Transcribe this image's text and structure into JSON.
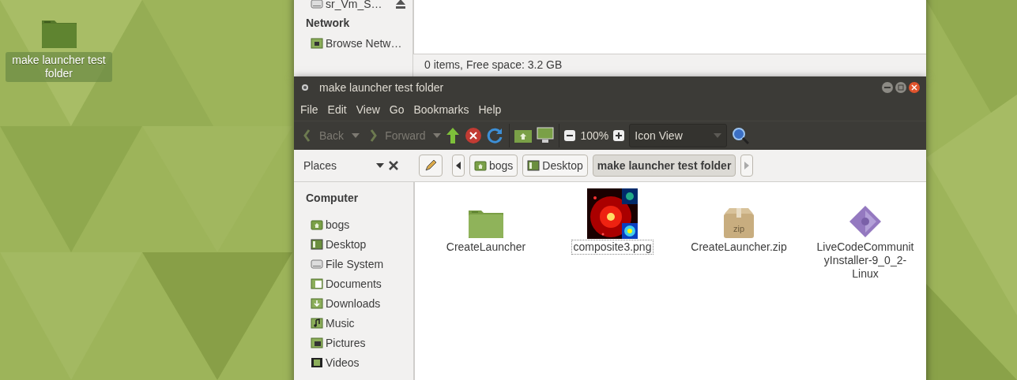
{
  "desktop": {
    "icons": [
      {
        "label": "make launcher test folder",
        "selected": true
      }
    ]
  },
  "back_window": {
    "sidebar": [
      {
        "label": "sr_Vm_S…",
        "kind": "drive",
        "eject": true
      },
      {
        "label": "Network",
        "kind": "heading"
      },
      {
        "label": "Browse Netw…",
        "kind": "network"
      }
    ],
    "status_bar": "0 items, Free space: 3.2 GB"
  },
  "window": {
    "title": "make launcher test folder",
    "menu": [
      "File",
      "Edit",
      "View",
      "Go",
      "Bookmarks",
      "Help"
    ],
    "toolbar": {
      "back": {
        "label": "Back",
        "disabled": true
      },
      "forward": {
        "label": "Forward",
        "disabled": true
      },
      "zoom": "100%",
      "view": "Icon View"
    },
    "places": "Places",
    "path": [
      {
        "label": "bogs",
        "kind": "home",
        "selected": false
      },
      {
        "label": "Desktop",
        "kind": "desktop",
        "selected": false
      },
      {
        "label": "make launcher test folder",
        "kind": "plain",
        "selected": true
      }
    ],
    "sidebar": {
      "heading": "Computer",
      "items": [
        {
          "label": "bogs",
          "kind": "home"
        },
        {
          "label": "Desktop",
          "kind": "desktop"
        },
        {
          "label": "File System",
          "kind": "drive"
        },
        {
          "label": "Documents",
          "kind": "documents"
        },
        {
          "label": "Downloads",
          "kind": "downloads"
        },
        {
          "label": "Music",
          "kind": "music"
        },
        {
          "label": "Pictures",
          "kind": "pictures"
        },
        {
          "label": "Videos",
          "kind": "videos"
        }
      ]
    },
    "files": [
      {
        "name": "CreateLauncher",
        "kind": "folder",
        "selected": false
      },
      {
        "name": "composite3.png",
        "selected": true
      },
      {
        "name": "CreateLauncher.zip",
        "kind": "zip",
        "selected": false
      },
      {
        "name": "LiveCodeCommunityInstaller-9_0_2-Linux",
        "kind": "app",
        "selected": false
      }
    ]
  }
}
